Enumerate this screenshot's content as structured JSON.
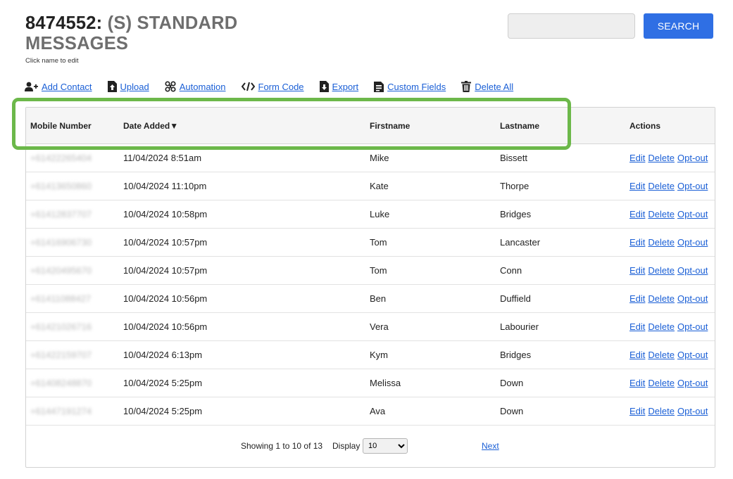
{
  "header": {
    "list_id": "8474552:",
    "list_name": "(S) STANDARD MESSAGES",
    "subtitle": "Click name to edit"
  },
  "search": {
    "value": "",
    "placeholder": "",
    "button_label": "SEARCH"
  },
  "toolbar": {
    "items": [
      {
        "label": "Add Contact",
        "icon": "add-contact-icon"
      },
      {
        "label": "Upload",
        "icon": "upload-icon"
      },
      {
        "label": "Automation",
        "icon": "automation-icon"
      },
      {
        "label": "Form Code",
        "icon": "code-icon"
      },
      {
        "label": "Export",
        "icon": "export-icon"
      },
      {
        "label": "Custom Fields",
        "icon": "custom-fields-icon"
      },
      {
        "label": "Delete All",
        "icon": "trash-icon"
      }
    ]
  },
  "table": {
    "columns": {
      "mobile": "Mobile Number",
      "date": "Date Added",
      "sort_indicator": "▼",
      "firstname": "Firstname",
      "lastname": "Lastname",
      "actions": "Actions"
    },
    "rows": [
      {
        "mobile": "+61422265404",
        "date": "11/04/2024 8:51am",
        "firstname": "Mike",
        "lastname": "Bissett"
      },
      {
        "mobile": "+61413650860",
        "date": "10/04/2024 11:10pm",
        "firstname": "Kate",
        "lastname": "Thorpe"
      },
      {
        "mobile": "+61412837707",
        "date": "10/04/2024 10:58pm",
        "firstname": "Luke",
        "lastname": "Bridges"
      },
      {
        "mobile": "+61416906730",
        "date": "10/04/2024 10:57pm",
        "firstname": "Tom",
        "lastname": "Lancaster"
      },
      {
        "mobile": "+61420495670",
        "date": "10/04/2024 10:57pm",
        "firstname": "Tom",
        "lastname": "Conn"
      },
      {
        "mobile": "+61411088427",
        "date": "10/04/2024 10:56pm",
        "firstname": "Ben",
        "lastname": "Duffield"
      },
      {
        "mobile": "+61421026716",
        "date": "10/04/2024 10:56pm",
        "firstname": "Vera",
        "lastname": "Labourier"
      },
      {
        "mobile": "+61422159707",
        "date": "10/04/2024 6:13pm",
        "firstname": "Kym",
        "lastname": "Bridges"
      },
      {
        "mobile": "+61408248870",
        "date": "10/04/2024 5:25pm",
        "firstname": "Melissa",
        "lastname": "Down"
      },
      {
        "mobile": "+61447191274",
        "date": "10/04/2024 5:25pm",
        "firstname": "Ava",
        "lastname": "Down"
      }
    ],
    "row_actions": {
      "edit": "Edit",
      "delete": "Delete",
      "optout": "Opt-out"
    }
  },
  "pagination": {
    "showing": "Showing 1 to 10 of 13",
    "display_label": "Display",
    "display_value": "10",
    "next_label": "Next"
  },
  "colors": {
    "accent": "#2f6fe4",
    "link": "#1a5fd6",
    "highlight": "#6cb84a"
  }
}
